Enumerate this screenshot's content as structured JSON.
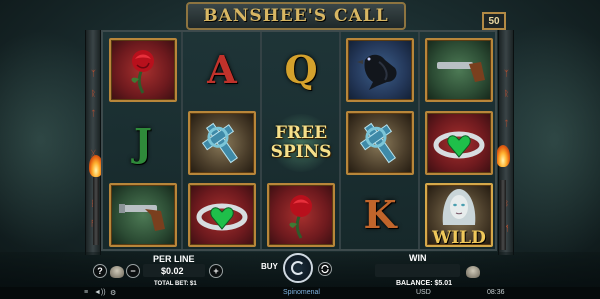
{
  "game": {
    "title": "BANSHEE'S CALL",
    "lines": "50"
  },
  "reels": {
    "columns": [
      [
        "rose",
        "gun",
        "pistol"
      ],
      [
        "A",
        "celtic-cross",
        "heart-ring"
      ],
      [
        "Q",
        "FREE SPINS",
        "rose"
      ],
      [
        "raven",
        "celtic-cross",
        "K"
      ],
      [
        "pistol",
        "heart-ring",
        "banshee-wild"
      ]
    ],
    "j_symbol": "J",
    "k_symbol": "K",
    "a_symbol": "A",
    "q_symbol": "Q",
    "free_spins_line1": "FREE",
    "free_spins_line2": "SPINS",
    "wild_label": "WILD"
  },
  "controls": {
    "help_label": "?",
    "per_line_label": "PER LINE",
    "per_line_value": "$0.02",
    "minus_label": "−",
    "plus_label": "+",
    "total_bet": "TOTAL BET: $1",
    "buy_label": "BUY",
    "win_label": "WIN",
    "balance": "BALANCE: $5.01"
  },
  "status": {
    "provider": "Spinomenal",
    "currency": "USD",
    "time": "08:36"
  },
  "colors": {
    "accent_gold": "#d7b663",
    "frame_gold": "#b8863a",
    "rune_orange": "#d4512a"
  }
}
